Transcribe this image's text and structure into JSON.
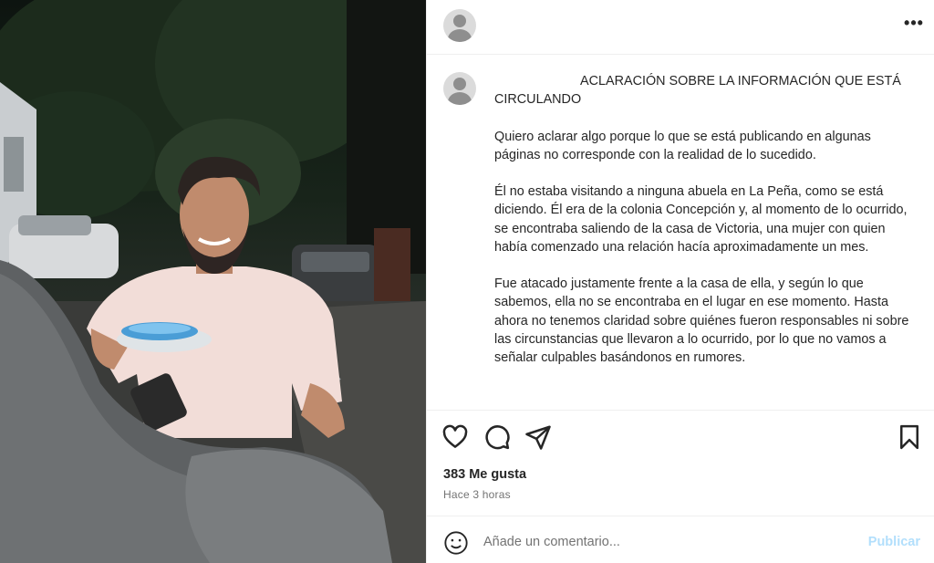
{
  "post": {
    "photo_alt": "",
    "header": {
      "avatar": "default-avatar",
      "more_label": "•••"
    },
    "caption": {
      "title": "ACLARACIÓN SOBRE LA INFORMACIÓN QUE ESTÁ CIRCULANDO",
      "paragraphs": [
        "Quiero aclarar algo porque lo que se está publicando en algunas páginas no corresponde con la realidad de lo sucedido.",
        "Él no estaba visitando a ninguna abuela en La Peña, como se está diciendo. Él era de la colonia Concepción y, al momento de lo ocurrido, se encontraba saliendo de la casa de Victoria, una mujer con quien había comenzado una relación hacía aproximadamente un mes.",
        "Fue atacado justamente frente a la casa de ella, y según lo que sabemos, ella no se encontraba en el lugar en ese momento. Hasta ahora no tenemos claridad sobre quiénes fueron responsables ni sobre las circunstancias que llevaron a lo ocurrido, por lo que no vamos a señalar culpables basándonos en rumores."
      ]
    },
    "likes": "383 Me gusta",
    "time": "Hace 3 horas",
    "comment": {
      "placeholder": "Añade un comentario...",
      "publish_label": "Publicar"
    },
    "icons": [
      "heart-icon",
      "comment-icon",
      "share-icon",
      "bookmark-icon",
      "emoji-icon"
    ]
  }
}
